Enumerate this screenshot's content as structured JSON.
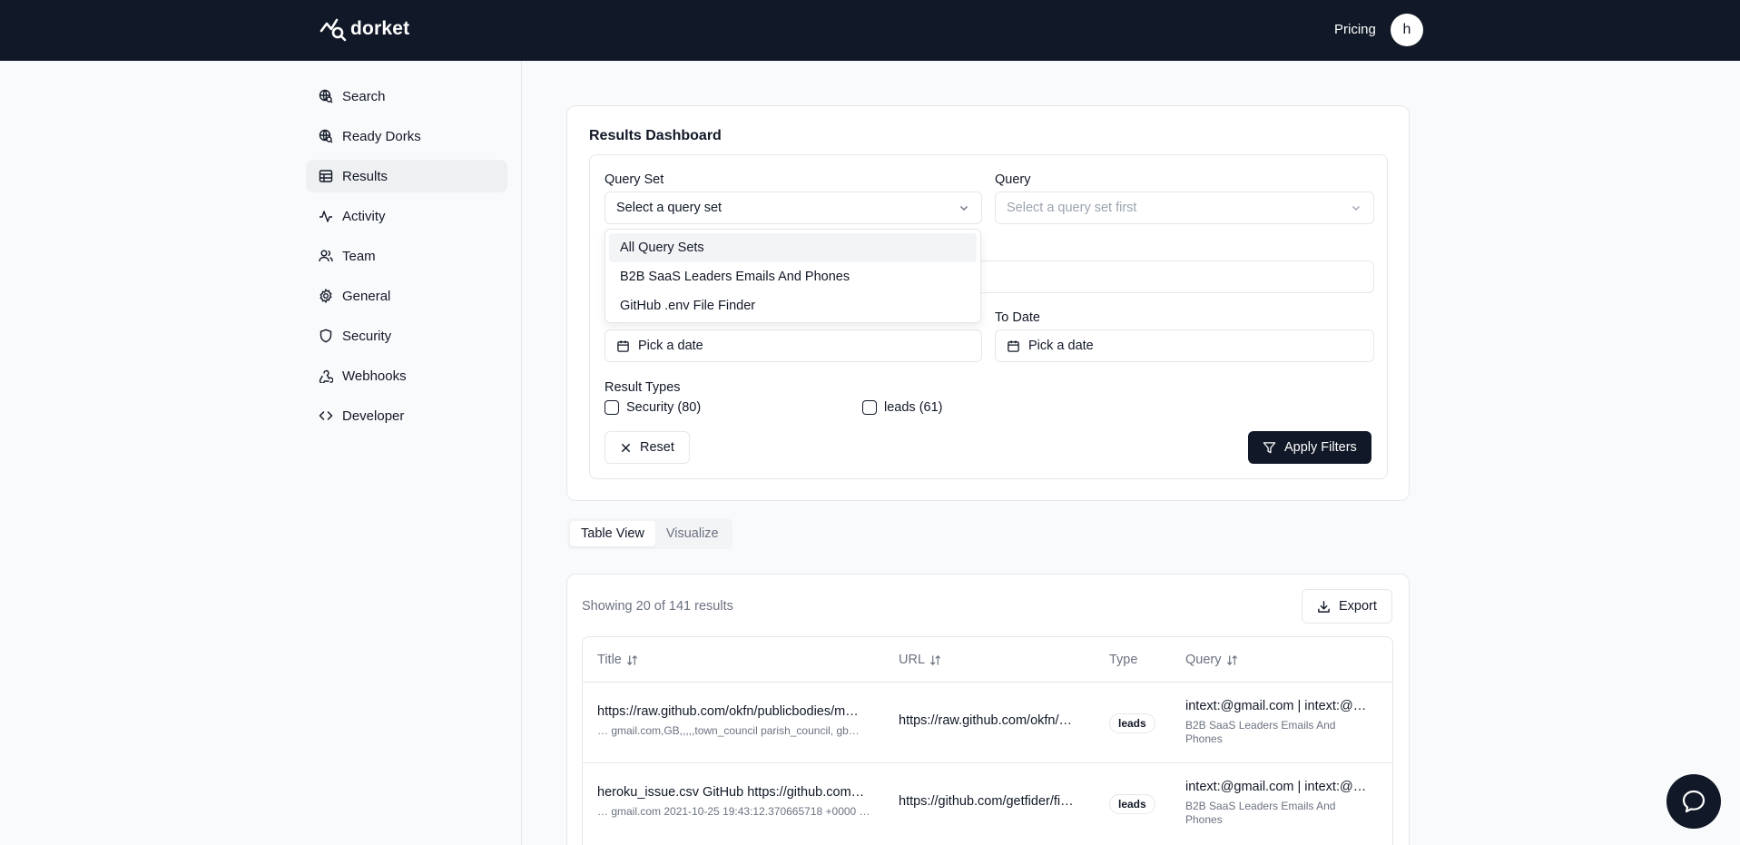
{
  "brand": {
    "name": "dorket"
  },
  "header": {
    "pricing_label": "Pricing",
    "avatar_initial": "h"
  },
  "sidebar": {
    "items": [
      {
        "label": "Search",
        "icon": "search-globe-icon"
      },
      {
        "label": "Ready Dorks",
        "icon": "search-globe-icon"
      },
      {
        "label": "Results",
        "icon": "table-icon",
        "active": true
      },
      {
        "label": "Activity",
        "icon": "activity-icon"
      },
      {
        "label": "Team",
        "icon": "users-icon"
      },
      {
        "label": "General",
        "icon": "gear-icon"
      },
      {
        "label": "Security",
        "icon": "shield-icon"
      },
      {
        "label": "Webhooks",
        "icon": "webhook-icon"
      },
      {
        "label": "Developer",
        "icon": "code-icon"
      }
    ]
  },
  "filters": {
    "title": "Results Dashboard",
    "query_set_label": "Query Set",
    "query_set_placeholder": "Select a query set",
    "query_label": "Query",
    "query_placeholder": "Select a query set first",
    "to_date_label": "To Date",
    "from_date_placeholder": "Pick a date",
    "to_date_placeholder": "Pick a date",
    "result_types_label": "Result Types",
    "types": [
      {
        "label": "Security (80)",
        "checked": false
      },
      {
        "label": "leads (61)",
        "checked": false
      }
    ],
    "reset_label": "Reset",
    "apply_label": "Apply Filters"
  },
  "dropdown": {
    "options": [
      "All Query Sets",
      "B2B SaaS Leaders Emails And Phones",
      "GitHub .env File Finder"
    ],
    "highlighted": "All Query Sets"
  },
  "view_tabs": {
    "table": "Table View",
    "visualize": "Visualize",
    "active": "Table View"
  },
  "results": {
    "showing": "Showing 20 of 141 results",
    "export_label": "Export",
    "columns": {
      "title": "Title",
      "url": "URL",
      "type": "Type",
      "query": "Query"
    },
    "rows": [
      {
        "title": "https://raw.github.com/okfn/publicbodies/m…",
        "snippet": "… gmail.com,GB,,,,,town_council parish_council, gb…",
        "url": "https://raw.github.com/okfn/…",
        "type": "leads",
        "query": "intext:@gmail.com | intext:@…",
        "query_set": "B2B SaaS Leaders Emails And Phones"
      },
      {
        "title": "heroku_issue.csv GitHub https://github.com…",
        "snippet": "… gmail.com 2021-10-25 19:43:12.370665718 +0000 …",
        "url": "https://github.com/getfider/fi…",
        "type": "leads",
        "query": "intext:@gmail.com | intext:@…",
        "query_set": "B2B SaaS Leaders Emails And Phones"
      }
    ]
  },
  "colors": {
    "topbar": "#111827",
    "accent": "#111827",
    "border": "#e5e7eb",
    "muted": "#6b7280"
  }
}
